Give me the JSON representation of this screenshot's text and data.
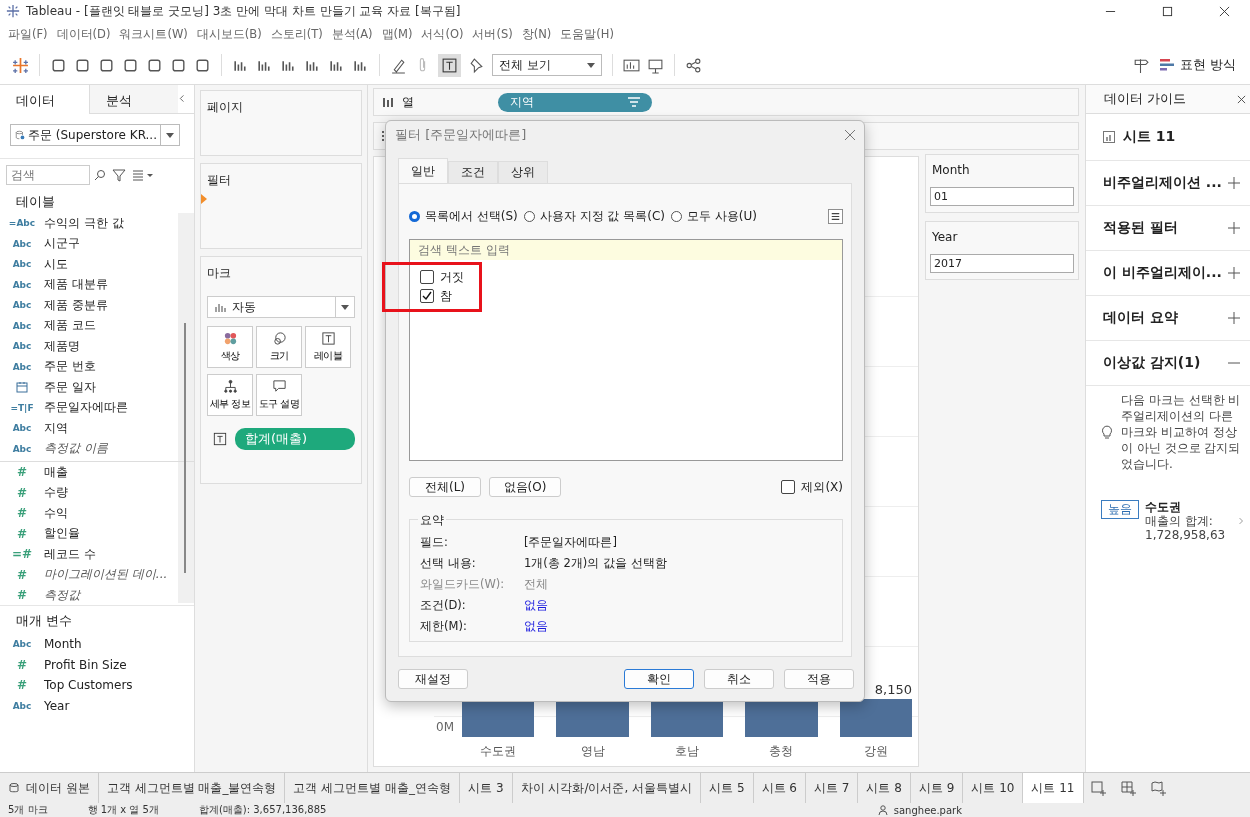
{
  "window": {
    "title": "Tableau - [플랜잇 태블로 굿모닝] 3초 만에 막대 차트 만들기 교육 자료 [복구됨]"
  },
  "menu": [
    "파일(F)",
    "데이터(D)",
    "워크시트(W)",
    "대시보드(B)",
    "스토리(T)",
    "분석(A)",
    "맵(M)",
    "서식(O)",
    "서버(S)",
    "창(N)",
    "도움말(H)"
  ],
  "toolbar": {
    "fit": "전체 보기",
    "show_me": "표현 방식"
  },
  "data_pane": {
    "tabs": [
      {
        "label": "데이터",
        "selected": true
      },
      {
        "label": "분석",
        "selected": false
      }
    ],
    "source": "주문 (Superstore KR...",
    "search": {
      "placeholder": "검색"
    },
    "tables_heading": "테이블",
    "fields": [
      {
        "kind": "dimension",
        "badge": "=Abc",
        "name": "수익의 극한 값",
        "italic": false
      },
      {
        "kind": "dimension",
        "badge": "Abc",
        "name": "시군구",
        "italic": false
      },
      {
        "kind": "dimension",
        "badge": "Abc",
        "name": "시도",
        "italic": false
      },
      {
        "kind": "dimension",
        "badge": "Abc",
        "name": "제품 대분류",
        "italic": false
      },
      {
        "kind": "dimension",
        "badge": "Abc",
        "name": "제품 중분류",
        "italic": false
      },
      {
        "kind": "dimension",
        "badge": "Abc",
        "name": "제품 코드",
        "italic": false
      },
      {
        "kind": "dimension",
        "badge": "Abc",
        "name": "제품명",
        "italic": false
      },
      {
        "kind": "dimension",
        "badge": "Abc",
        "name": "주문 번호",
        "italic": false
      },
      {
        "kind": "date",
        "name": "주문 일자",
        "italic": false
      },
      {
        "kind": "dimension",
        "badge": "=T|F",
        "name": "주문일자에따른",
        "italic": false
      },
      {
        "kind": "dimension",
        "badge": "Abc",
        "name": "지역",
        "italic": false
      },
      {
        "kind": "dimension",
        "badge": "Abc",
        "name": "측정값 이름",
        "italic": true
      },
      {
        "kind": "measure",
        "badge": "#",
        "name": "매출",
        "italic": false
      },
      {
        "kind": "measure",
        "badge": "#",
        "name": "수량",
        "italic": false
      },
      {
        "kind": "measure",
        "badge": "#",
        "name": "수익",
        "italic": false
      },
      {
        "kind": "measure",
        "badge": "#",
        "name": "할인율",
        "italic": false
      },
      {
        "kind": "measure",
        "badge": "=#",
        "name": "레코드 수",
        "italic": false
      },
      {
        "kind": "measure",
        "badge": "#",
        "name": "마이그레이션된 데이...",
        "italic": true
      },
      {
        "kind": "measure",
        "badge": "#",
        "name": "측정값",
        "italic": true
      }
    ],
    "parameters_heading": "매개 변수",
    "parameters": [
      {
        "kind": "dimension",
        "badge": "Abc",
        "name": "Month"
      },
      {
        "kind": "measure",
        "badge": "#",
        "name": "Profit Bin Size"
      },
      {
        "kind": "measure",
        "badge": "#",
        "name": "Top Customers"
      },
      {
        "kind": "dimension",
        "badge": "Abc",
        "name": "Year"
      }
    ]
  },
  "shelves": {
    "pages": "페이지",
    "filters": "필터",
    "marks": {
      "title": "마크",
      "type": "자동",
      "buttons": [
        {
          "kind": "color",
          "label": "색상"
        },
        {
          "kind": "size",
          "label": "크기"
        },
        {
          "kind": "label",
          "label": "레이블"
        },
        {
          "kind": "detail",
          "label": "세부 정보"
        },
        {
          "kind": "tooltip",
          "label": "도구 설명"
        }
      ],
      "pill": "합계(매출)"
    },
    "columns": {
      "label": "열",
      "pill": "지역"
    }
  },
  "parameter_cards": [
    {
      "name": "Month",
      "value": "01"
    },
    {
      "name": "Year",
      "value": "2017"
    }
  ],
  "view": {
    "axis_label": "0M",
    "bar_label": "8,150",
    "categories": [
      "수도권",
      "영남",
      "호남",
      "충청",
      "강원"
    ]
  },
  "dialog": {
    "title": "필터 [주문일자에따른]",
    "tabs": [
      {
        "label": "일반",
        "selected": true
      },
      {
        "label": "조건",
        "selected": false
      },
      {
        "label": "상위",
        "selected": false
      }
    ],
    "radios": [
      {
        "label": "목록에서 선택(S)",
        "selected": true
      },
      {
        "label": "사용자 지정 값 목록(C)",
        "selected": false
      },
      {
        "label": "모두 사용(U)",
        "selected": false
      }
    ],
    "search": {
      "placeholder": "검색 텍스트 입력"
    },
    "items": [
      {
        "label": "거짓",
        "checked": false
      },
      {
        "label": "참",
        "checked": true
      }
    ],
    "select_buttons": [
      "전체(L)",
      "없음(O)"
    ],
    "exclude": {
      "label": "제외(X)",
      "checked": false
    },
    "summary_title": "요약",
    "summary": [
      {
        "kind": "normal",
        "label": "필드:",
        "value": "[주문일자에따른]"
      },
      {
        "kind": "normal",
        "label": "선택 내용:",
        "value": "1개(총 2개)의 값을 선택함"
      },
      {
        "kind": "disabled",
        "label": "와일드카드(W):",
        "value": "전체"
      },
      {
        "kind": "link",
        "label": "조건(D):",
        "value": "없음"
      },
      {
        "kind": "link",
        "label": "제한(M):",
        "value": "없음"
      }
    ],
    "reset": "재설정",
    "buttons": [
      {
        "label": "확인",
        "default": true
      },
      {
        "label": "취소",
        "default": false
      },
      {
        "label": "적용",
        "default": false
      }
    ]
  },
  "guide": {
    "title": "데이터 가이드",
    "sheet": "시트 11",
    "sections": [
      {
        "label": "비주얼리제이션 ...",
        "expanded": false
      },
      {
        "label": "적용된 필터",
        "expanded": false
      },
      {
        "label": "이 비주얼리제이...",
        "expanded": false
      },
      {
        "label": "데이터 요약",
        "expanded": false
      },
      {
        "label": "이상값 감지(1)",
        "expanded": true
      }
    ],
    "insight": "다음 마크는 선택한 비주얼리제이션의 다른 마크와 비교하여 정상이 아닌 것으로 감지되었습니다.",
    "outlier": {
      "badge": "높음",
      "name": "수도권",
      "detail": "매출의 합계: 1,728,958,63"
    }
  },
  "sheet_tabs": {
    "source": "데이터 원본",
    "sheets": [
      {
        "label": "고객 세그먼트별 매출_불연속형",
        "selected": false
      },
      {
        "label": "고객 세그먼트별 매출_연속형",
        "selected": false
      },
      {
        "label": "시트 3",
        "selected": false
      },
      {
        "label": "차이 시각화/이서준, 서울특별시",
        "selected": false
      },
      {
        "label": "시트 5",
        "selected": false
      },
      {
        "label": "시트 6",
        "selected": false
      },
      {
        "label": "시트 7",
        "selected": false
      },
      {
        "label": "시트 8",
        "selected": false
      },
      {
        "label": "시트 9",
        "selected": false
      },
      {
        "label": "시트 10",
        "selected": false
      },
      {
        "label": "시트 11",
        "selected": true
      }
    ]
  },
  "status_bar": {
    "marks": "5개 마크",
    "dims": "행 1개 x 열 5개",
    "sum": "합계(매출): 3,657,136,885",
    "user": "sanghee.park"
  }
}
